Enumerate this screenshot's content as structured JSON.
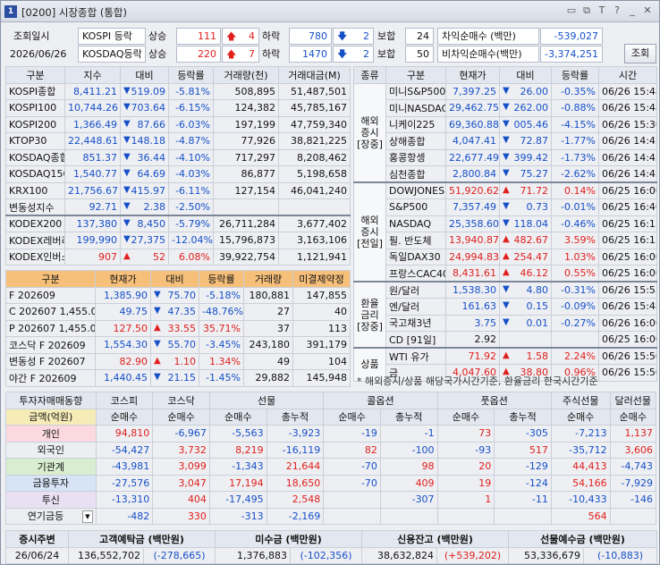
{
  "window": {
    "num": "1",
    "title": "[0200] 시장종합 (통합)"
  },
  "titlebar_icons": [
    "restore-icon",
    "copy-icon",
    "text-icon",
    "help-icon",
    "minimize-icon",
    "close-icon"
  ],
  "summary": {
    "query_date_label": "조회일시",
    "query_date": "2026/06/26",
    "kospi_label": "KOSPI 등락",
    "kosdaq_label": "KOSDAQ등락",
    "rise_label": "상승",
    "fall_label": "하락",
    "flat_label": "보합",
    "kospi_up": "111",
    "kospi_up_limit": "4",
    "kospi_down": "780",
    "kospi_down_limit": "2",
    "kospi_flat": "24",
    "kosdaq_up": "220",
    "kosdaq_up_limit": "7",
    "kosdaq_down": "1470",
    "kosdaq_down_limit": "2",
    "kosdaq_flat": "50",
    "arb_label": "차익순매수  (백만)",
    "arb_value": "-539,027",
    "nonarb_label": "비차익순매수(백만)",
    "nonarb_value": "-3,374,251",
    "query_button": "조회"
  },
  "index_table": {
    "headers": [
      "구분",
      "지수",
      "대비",
      "등락률",
      "거래량(천)",
      "거래대금(M)"
    ],
    "rows": [
      {
        "name": "KOSPI종합",
        "value": "8,411.21",
        "dir": "down",
        "chg": "519.09",
        "pct": "-5.81%",
        "vol": "508,895",
        "amt": "51,487,501"
      },
      {
        "name": "KOSPI100",
        "value": "10,744.26",
        "dir": "down",
        "chg": "703.64",
        "pct": "-6.15%",
        "vol": "124,382",
        "amt": "45,785,167"
      },
      {
        "name": "KOSPI200",
        "value": "1,366.49",
        "dir": "down",
        "chg": "87.66",
        "pct": "-6.03%",
        "vol": "197,199",
        "amt": "47,759,340"
      },
      {
        "name": "KTOP30",
        "value": "22,448.61",
        "dir": "down",
        "chg": "148.18",
        "pct": "-4.87%",
        "vol": "77,926",
        "amt": "38,821,225"
      },
      {
        "name": "KOSDAQ종합",
        "value": "851.37",
        "dir": "down",
        "chg": "36.44",
        "pct": "-4.10%",
        "vol": "717,297",
        "amt": "8,208,462"
      },
      {
        "name": "KOSDAQ150",
        "value": "1,540.77",
        "dir": "down",
        "chg": "64.69",
        "pct": "-4.03%",
        "vol": "86,877",
        "amt": "5,198,658"
      },
      {
        "name": "KRX100",
        "value": "21,756.67",
        "dir": "down",
        "chg": "415.97",
        "pct": "-6.11%",
        "vol": "127,154",
        "amt": "46,041,240"
      },
      {
        "name": "변동성지수",
        "value": "92.71",
        "dir": "down",
        "chg": "2.38",
        "pct": "-2.50%",
        "vol": "",
        "amt": ""
      },
      {
        "name": "KODEX200",
        "value": "137,380",
        "dir": "down",
        "chg": "8,450",
        "pct": "-5.79%",
        "vol": "26,711,284",
        "amt": "3,677,402"
      },
      {
        "name": "KODEX레버리",
        "value": "199,990",
        "dir": "down",
        "chg": "27,375",
        "pct": "-12.04%",
        "vol": "15,796,873",
        "amt": "3,163,106"
      },
      {
        "name": "KODEX인버스",
        "value": "907",
        "dir": "up",
        "chg": "52",
        "pct": "6.08%",
        "vol": "39,922,754",
        "amt": "1,121,941"
      }
    ]
  },
  "futures_table": {
    "headers": [
      "구분",
      "현재가",
      "대비",
      "등락률",
      "거래량",
      "미결제약정"
    ],
    "rows": [
      {
        "name": "F 202609",
        "value": "1,385.90",
        "dir": "down",
        "chg": "75.70",
        "pct": "-5.18%",
        "vol": "180,881",
        "oi": "147,855"
      },
      {
        "name": "C 202607 1,455.0",
        "value": "49.75",
        "dir": "down",
        "chg": "47.35",
        "pct": "-48.76%",
        "vol": "27",
        "oi": "40"
      },
      {
        "name": "P 202607 1,455.0",
        "value": "127.50",
        "dir": "up",
        "chg": "33.55",
        "pct": "35.71%",
        "vol": "37",
        "oi": "113"
      },
      {
        "name": "코스닥 F 202609",
        "value": "1,554.30",
        "dir": "down",
        "chg": "55.70",
        "pct": "-3.45%",
        "vol": "243,180",
        "oi": "391,179"
      },
      {
        "name": "변동성 F 202607",
        "value": "82.90",
        "dir": "up",
        "chg": "1.10",
        "pct": "1.34%",
        "vol": "49",
        "oi": "104"
      },
      {
        "name": "야간 F 202609",
        "value": "1,440.45",
        "dir": "down",
        "chg": "21.15",
        "pct": "-1.45%",
        "vol": "29,882",
        "oi": "145,948"
      }
    ]
  },
  "global_table": {
    "headers": [
      "종류",
      "구분",
      "현재가",
      "대비",
      "등락률",
      "시간"
    ],
    "groups": [
      {
        "label": "해외\n증시\n[장중]",
        "rows": [
          {
            "name": "미니S&P500",
            "value": "7,397.25",
            "dir": "down",
            "chg": "26.00",
            "pct": "-0.35%",
            "time": "06/26 15:48"
          },
          {
            "name": "미니NASDAQ",
            "value": "29,462.75",
            "dir": "down",
            "chg": "262.00",
            "pct": "-0.88%",
            "time": "06/26 15:48"
          },
          {
            "name": "니케이225",
            "value": "69,360.88",
            "dir": "down",
            "chg": "005.46",
            "pct": "-4.15%",
            "time": "06/26 15:30"
          },
          {
            "name": "상해종합",
            "value": "4,047.41",
            "dir": "down",
            "chg": "72.87",
            "pct": "-1.77%",
            "time": "06/26 14:43"
          },
          {
            "name": "홍콩항셍",
            "value": "22,677.49",
            "dir": "down",
            "chg": "399.42",
            "pct": "-1.73%",
            "time": "06/26 14:43"
          },
          {
            "name": "심천종합",
            "value": "2,800.84",
            "dir": "down",
            "chg": "75.27",
            "pct": "-2.62%",
            "time": "06/26 14:43"
          }
        ]
      },
      {
        "label": "해외\n증시\n[전일]",
        "rows": [
          {
            "name": "DOWJONES",
            "value": "51,920.62",
            "dir": "up",
            "chg": "71.72",
            "pct": "0.14%",
            "time": "06/25 16:00"
          },
          {
            "name": "S&P500",
            "value": "7,357.49",
            "dir": "down",
            "chg": "0.73",
            "pct": "-0.01%",
            "time": "06/25 16:46"
          },
          {
            "name": "NASDAQ",
            "value": "25,358.60",
            "dir": "down",
            "chg": "118.04",
            "pct": "-0.46%",
            "time": "06/25 16:15"
          },
          {
            "name": "필. 반도체",
            "value": "13,940.87",
            "dir": "up",
            "chg": "482.67",
            "pct": "3.59%",
            "time": "06/25 16:15"
          },
          {
            "name": "독일DAX30",
            "value": "24,994.83",
            "dir": "up",
            "chg": "254.47",
            "pct": "1.03%",
            "time": "06/25 16:00"
          },
          {
            "name": "프랑스CAC40",
            "value": "8,431.61",
            "dir": "up",
            "chg": "46.12",
            "pct": "0.55%",
            "time": "06/25 16:00"
          }
        ]
      },
      {
        "label": "환율\n금리\n[장중]",
        "rows": [
          {
            "name": "원/달러",
            "value": "1,538.30",
            "dir": "down",
            "chg": "4.80",
            "pct": "-0.31%",
            "time": "06/26 15:53"
          },
          {
            "name": "엔/달러",
            "value": "161.63",
            "dir": "down",
            "chg": "0.15",
            "pct": "-0.09%",
            "time": "06/26 15:48"
          },
          {
            "name": "국고채3년",
            "value": "3.75",
            "dir": "down",
            "chg": "0.01",
            "pct": "-0.27%",
            "time": "06/26 16:00"
          },
          {
            "name": "CD [91일]",
            "value": "2.92",
            "dir": "",
            "chg": "",
            "pct": "",
            "time": "06/25 16:00"
          }
        ]
      },
      {
        "label": "상품",
        "rows": [
          {
            "name": "WTI 유가",
            "value": "71.92",
            "dir": "up",
            "chg": "1.58",
            "pct": "2.24%",
            "time": "06/26 15:50"
          },
          {
            "name": "금",
            "value": "4,047.60",
            "dir": "up",
            "chg": "38.80",
            "pct": "0.96%",
            "time": "06/26 15:50"
          }
        ]
      }
    ],
    "note": "* 해외증시/상품 해당국가시간기준, 환율금리 한국시간기준"
  },
  "investor_table": {
    "header_top": [
      "투자자매매동향",
      "코스피",
      "코스닥",
      "선물",
      "콜옵션",
      "풋옵션",
      "주식선물",
      "달러선물"
    ],
    "unit_label": "금액(억원)",
    "sub_headers": [
      "순매수",
      "순매수",
      "순매수",
      "총누적",
      "순매수",
      "총누적",
      "순매수",
      "총누적",
      "순매수",
      "순매수"
    ],
    "rows": [
      {
        "name": "개인",
        "vals": [
          "94,810",
          "-6,967",
          "-5,563",
          "-3,923",
          "-19",
          "-1",
          "73",
          "-305",
          "-7,213",
          "1,137"
        ]
      },
      {
        "name": "외국인",
        "vals": [
          "-54,427",
          "3,732",
          "8,219",
          "-16,119",
          "82",
          "-100",
          "-93",
          "517",
          "-35,712",
          "3,606"
        ]
      },
      {
        "name": "기관계",
        "vals": [
          "-43,981",
          "3,099",
          "-1,343",
          "21,644",
          "-70",
          "98",
          "20",
          "-129",
          "44,413",
          "-4,743"
        ]
      },
      {
        "name": "금융투자",
        "vals": [
          "-27,576",
          "3,047",
          "17,194",
          "18,650",
          "-70",
          "409",
          "19",
          "-124",
          "54,166",
          "-7,929"
        ]
      },
      {
        "name": "투신",
        "vals": [
          "-13,310",
          "404",
          "-17,495",
          "2,548",
          "",
          "-307",
          "1",
          "-11",
          "-10,433",
          "-146"
        ]
      },
      {
        "name": "연기금등",
        "vals": [
          "-482",
          "330",
          "-313",
          "-2,169",
          "",
          "",
          "",
          "",
          "564",
          ""
        ]
      }
    ]
  },
  "deposit_table": {
    "headers": [
      "증시주변",
      "고객예탁금 (백만원)",
      "미수금 (백만원)",
      "신용잔고 (백만원)",
      "선물예수금 (백만원)"
    ],
    "date": "26/06/24",
    "cols": [
      {
        "value": "136,552,702",
        "chg": "-278,665"
      },
      {
        "value": "1,376,883",
        "chg": "-102,356"
      },
      {
        "value": "38,632,824",
        "chg": "+539,202"
      },
      {
        "value": "53,336,679",
        "chg": "-10,883"
      }
    ]
  }
}
